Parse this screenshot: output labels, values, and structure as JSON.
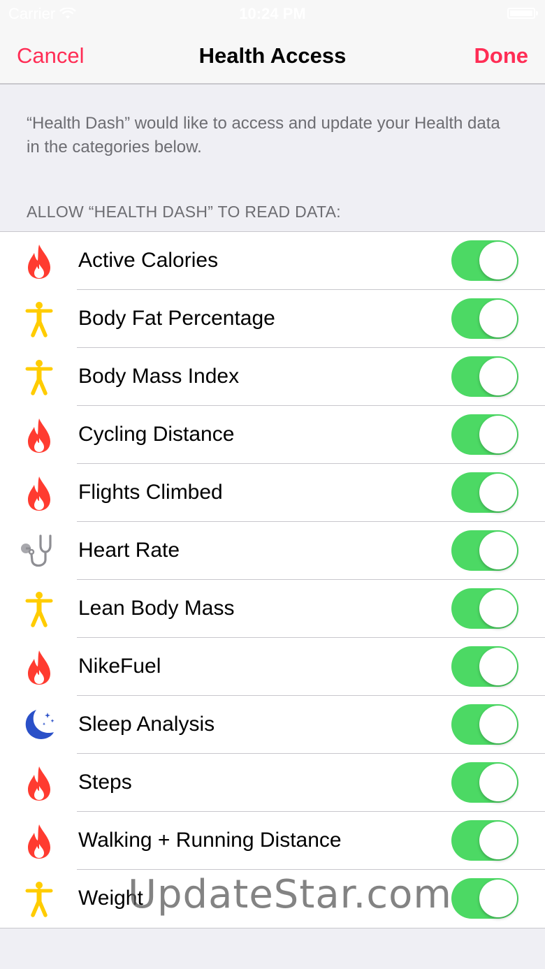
{
  "status_bar": {
    "carrier": "Carrier",
    "time": "10:24 PM"
  },
  "nav": {
    "cancel": "Cancel",
    "title": "Health Access",
    "done": "Done"
  },
  "intro_text": "“Health Dash” would like to access and update your Health data in the categories below.",
  "section_header": "ALLOW “HEALTH DASH” TO READ DATA:",
  "colors": {
    "accent": "#ff2d55",
    "toggle_on": "#4cd964",
    "fitness": "#ff3b30",
    "body": "#ffcc00",
    "vitals": "#8e8e93",
    "sleep": "#2a50c8"
  },
  "items": [
    {
      "label": "Active Calories",
      "icon": "flame-icon",
      "on": true
    },
    {
      "label": "Body Fat Percentage",
      "icon": "body-icon",
      "on": true
    },
    {
      "label": "Body Mass Index",
      "icon": "body-icon",
      "on": true
    },
    {
      "label": "Cycling Distance",
      "icon": "flame-icon",
      "on": true
    },
    {
      "label": "Flights Climbed",
      "icon": "flame-icon",
      "on": true
    },
    {
      "label": "Heart Rate",
      "icon": "stethoscope-icon",
      "on": true
    },
    {
      "label": "Lean Body Mass",
      "icon": "body-icon",
      "on": true
    },
    {
      "label": "NikeFuel",
      "icon": "flame-icon",
      "on": true
    },
    {
      "label": "Sleep Analysis",
      "icon": "moon-icon",
      "on": true
    },
    {
      "label": "Steps",
      "icon": "flame-icon",
      "on": true
    },
    {
      "label": "Walking + Running Distance",
      "icon": "flame-icon",
      "on": true
    },
    {
      "label": "Weight",
      "icon": "body-icon",
      "on": true
    }
  ],
  "watermark": "UpdateStar.com"
}
